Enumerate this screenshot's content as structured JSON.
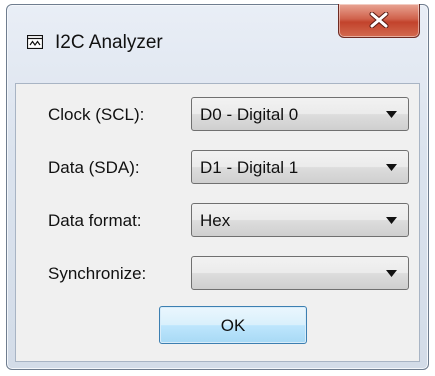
{
  "window": {
    "title": "I2C Analyzer",
    "close_icon": "close-x-icon",
    "title_icon": "analyzer-window-icon"
  },
  "form": {
    "rows": [
      {
        "label": "Clock (SCL):",
        "value": "D0 - Digital 0"
      },
      {
        "label": "Data (SDA):",
        "value": "D1 - Digital 1"
      },
      {
        "label": "Data format:",
        "value": "Hex"
      },
      {
        "label": "Synchronize:",
        "value": ""
      }
    ]
  },
  "buttons": {
    "ok_label": "OK"
  },
  "colors": {
    "close_button": "#c7462f",
    "ok_button": "#bee6fd",
    "dialog_background": "#f0f0f0"
  }
}
